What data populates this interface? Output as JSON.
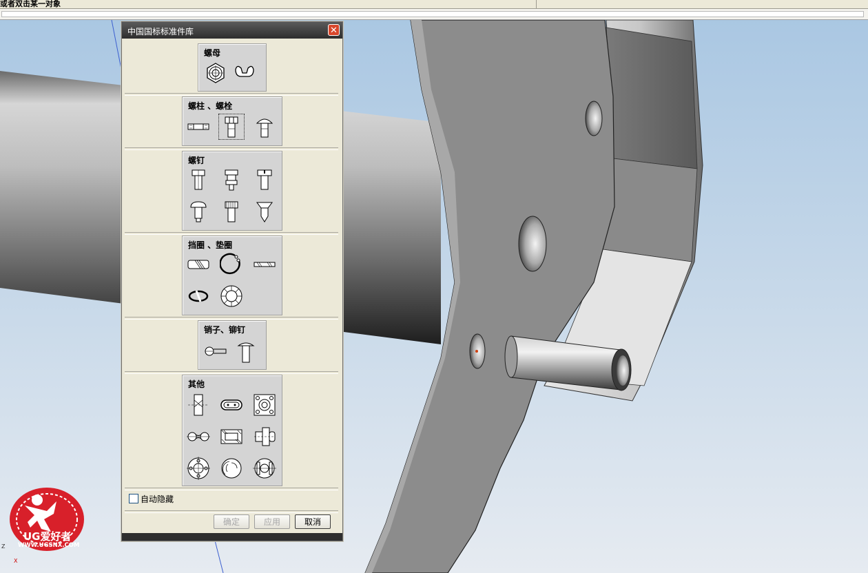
{
  "status": {
    "prompt_text": "或者双击某一对象"
  },
  "dialog": {
    "title": "中国国标标准件库",
    "close_symbol": "✕",
    "groups": [
      {
        "title": "螺母",
        "icons": [
          "hex-nut-icon",
          "wing-nut-icon"
        ]
      },
      {
        "title": "螺柱 、螺栓",
        "icons": [
          "stud-icon",
          "hex-bolt-icon",
          "round-head-bolt-icon"
        ]
      },
      {
        "title": "螺钉",
        "icons": [
          "cap-screw-icon",
          "shoulder-screw-icon",
          "slotted-screw-icon",
          "pan-head-screw-icon",
          "knurled-screw-icon",
          "countersunk-screw-icon"
        ]
      },
      {
        "title": "挡圈 、垫圈",
        "icons": [
          "shaft-collar-icon",
          "retaining-ring-icon",
          "flat-washer-icon",
          "spring-washer-icon",
          "lock-washer-icon"
        ]
      },
      {
        "title": "销子、铆钉",
        "icons": [
          "split-pin-icon",
          "rivet-icon"
        ]
      },
      {
        "title": "其他",
        "icons": [
          "key-block-icon",
          "link-plate-icon",
          "flange-square-icon",
          "chain-link-icon",
          "bearing-section-icon",
          "coupling-icon",
          "round-flange-icon",
          "spiral-disc-icon",
          "bearing-round-icon"
        ]
      }
    ],
    "selected_icon": "hex-bolt-icon",
    "auto_hide_label": "自动隐藏",
    "auto_hide_checked": false,
    "buttons": {
      "ok": "确定",
      "apply": "应用",
      "cancel": "取消"
    }
  },
  "watermark": {
    "brand": "UG爱好者",
    "url": "WWW.UGSNX.COM"
  },
  "axes": {
    "z": "Z",
    "x": "X"
  },
  "colors": {
    "titlebar": "#2e2e2e",
    "dialog_bg": "#ece9d8",
    "group_bg": "#d4d4d4",
    "logo_red": "#d8202a",
    "model_gray": "#8e8e8e"
  }
}
